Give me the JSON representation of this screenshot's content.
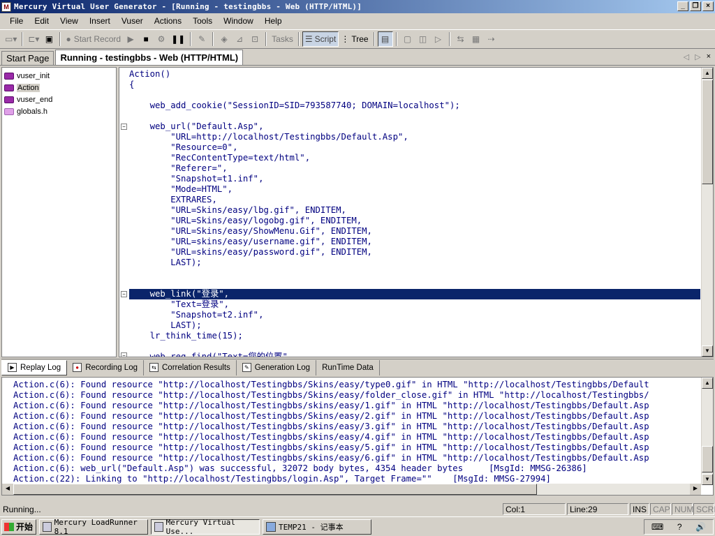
{
  "window": {
    "title": "Mercury Virtual User Generator - [Running - testingbbs - Web (HTTP/HTML)]",
    "app_icon": "M",
    "minimize": "_",
    "restore": "❐",
    "close": "×"
  },
  "menu": [
    "File",
    "Edit",
    "View",
    "Insert",
    "Vuser",
    "Actions",
    "Tools",
    "Window",
    "Help"
  ],
  "toolbar": {
    "start_record": "Start Record",
    "tasks": "Tasks",
    "script": "Script",
    "tree": "Tree"
  },
  "tabs": [
    "Start Page",
    "Running - testingbbs - Web (HTTP/HTML)"
  ],
  "tab_nav": {
    "prev": "◁",
    "next": "▷",
    "close": "×"
  },
  "tree_items": [
    "vuser_init",
    "Action",
    "vuser_end",
    "globals.h"
  ],
  "code_lines": [
    "Action()",
    "{",
    "",
    "    web_add_cookie(\"SessionID=SID=793587740; DOMAIN=localhost\");",
    "",
    "    web_url(\"Default.Asp\",",
    "        \"URL=http://localhost/Testingbbs/Default.Asp\",",
    "        \"Resource=0\",",
    "        \"RecContentType=text/html\",",
    "        \"Referer=\",",
    "        \"Snapshot=t1.inf\",",
    "        \"Mode=HTML\",",
    "        EXTRARES,",
    "        \"URL=Skins/easy/lbg.gif\", ENDITEM,",
    "        \"URL=Skins/easy/logobg.gif\", ENDITEM,",
    "        \"URL=Skins/easy/ShowMenu.Gif\", ENDITEM,",
    "        \"URL=skins/easy/username.gif\", ENDITEM,",
    "        \"URL=skins/easy/password.gif\", ENDITEM,",
    "        LAST);",
    "",
    "",
    "    web_link(\"登录\",",
    "        \"Text=登录\",",
    "        \"Snapshot=t2.inf\",",
    "        LAST);",
    "    lr_think_time(15);",
    "",
    "    web_reg_find(\"Text=您的位置\""
  ],
  "log_tabs": [
    "Replay Log",
    "Recording Log",
    "Correlation Results",
    "Generation Log",
    "RunTime Data"
  ],
  "log_lines": [
    "Action.c(6): Found resource \"http://localhost/Testingbbs/Skins/easy/type0.gif\" in HTML \"http://localhost/Testingbbs/Default",
    "Action.c(6): Found resource \"http://localhost/Testingbbs/Skins/easy/folder_close.gif\" in HTML \"http://localhost/Testingbbs/",
    "Action.c(6): Found resource \"http://localhost/Testingbbs/skins/easy/1.gif\" in HTML \"http://localhost/Testingbbs/Default.Asp",
    "Action.c(6): Found resource \"http://localhost/Testingbbs/Skins/easy/2.gif\" in HTML \"http://localhost/Testingbbs/Default.Asp",
    "Action.c(6): Found resource \"http://localhost/Testingbbs/skins/easy/3.gif\" in HTML \"http://localhost/Testingbbs/Default.Asp",
    "Action.c(6): Found resource \"http://localhost/Testingbbs/skins/easy/4.gif\" in HTML \"http://localhost/Testingbbs/Default.Asp",
    "Action.c(6): Found resource \"http://localhost/Testingbbs/skins/easy/5.gif\" in HTML \"http://localhost/Testingbbs/Default.Asp",
    "Action.c(6): Found resource \"http://localhost/Testingbbs/skins/easy/6.gif\" in HTML \"http://localhost/Testingbbs/Default.Asp",
    "Action.c(6): web_url(\"Default.Asp\") was successful, 32072 body bytes, 4354 header bytes     [MsgId: MMSG-26386]",
    "Action.c(22): Linking to \"http://localhost/Testingbbs/login.Asp\", Target Frame=\"\"    [MsgId: MMSG-27994]"
  ],
  "status": {
    "text": "Running...",
    "col": "Col:1",
    "line": "Line:29",
    "ins": "INS",
    "cap": "CAP",
    "num": "NUM",
    "scrl": "SCRL"
  },
  "taskbar": {
    "start": "开始",
    "tasks": [
      "Mercury LoadRunner 8.1",
      "Mercury Virtual Use...",
      "TEMP21 - 记事本"
    ]
  },
  "tray": {
    "keyboard": "⌨",
    "help": "?",
    "volume": "🔊"
  },
  "icons": [
    "app-icon",
    "new-icon",
    "open-icon",
    "save-icon",
    "record-icon",
    "play-icon",
    "stop-icon",
    "pause-icon",
    "script-icon",
    "tree-icon"
  ]
}
